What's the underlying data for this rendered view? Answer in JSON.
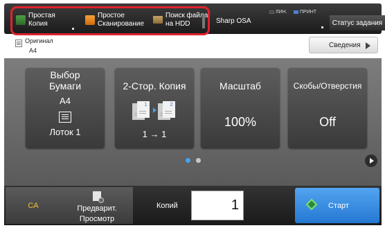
{
  "topbar": {
    "modes": [
      {
        "label_line1": "Простая",
        "label_line2": "Копия",
        "icon": "copy-icon"
      },
      {
        "label_line1": "Простое",
        "label_line2": "Сканирование",
        "icon": "scan-icon"
      },
      {
        "label_line1": "Поиск файла",
        "label_line2": "на HDD",
        "icon": "folder-icon"
      }
    ],
    "sharp_osa": "Sharp OSA",
    "line_indicator": "ЛИН.",
    "print_indicator": "ПРИНТ",
    "job_status": "Статус задания"
  },
  "original": {
    "label": "Оригинал",
    "value": "A4"
  },
  "info_button": "Сведения",
  "tiles": {
    "paper": {
      "title_line1": "Выбор",
      "title_line2": "Бумаги",
      "size": "A4",
      "tray": "Лоток 1"
    },
    "duplex": {
      "title": "2-Стор. Копия",
      "page1": "1",
      "page2": "2",
      "value": "1 → 1"
    },
    "zoom": {
      "title": "Масштаб",
      "value": "100%"
    },
    "staple": {
      "title": "Скобы/Отверстия",
      "value": "Off"
    }
  },
  "pagination": {
    "current": 1,
    "total": 2
  },
  "bottom": {
    "ca": "CA",
    "preview_line1": "Предварит.",
    "preview_line2": "Просмотр",
    "copies_label": "Копий",
    "copies_value": "1",
    "start": "Старт"
  },
  "colors": {
    "accent": "#4aa3ef",
    "start": "#3a8fe3",
    "ca": "#f3c432",
    "highlight": "#e0232e"
  }
}
